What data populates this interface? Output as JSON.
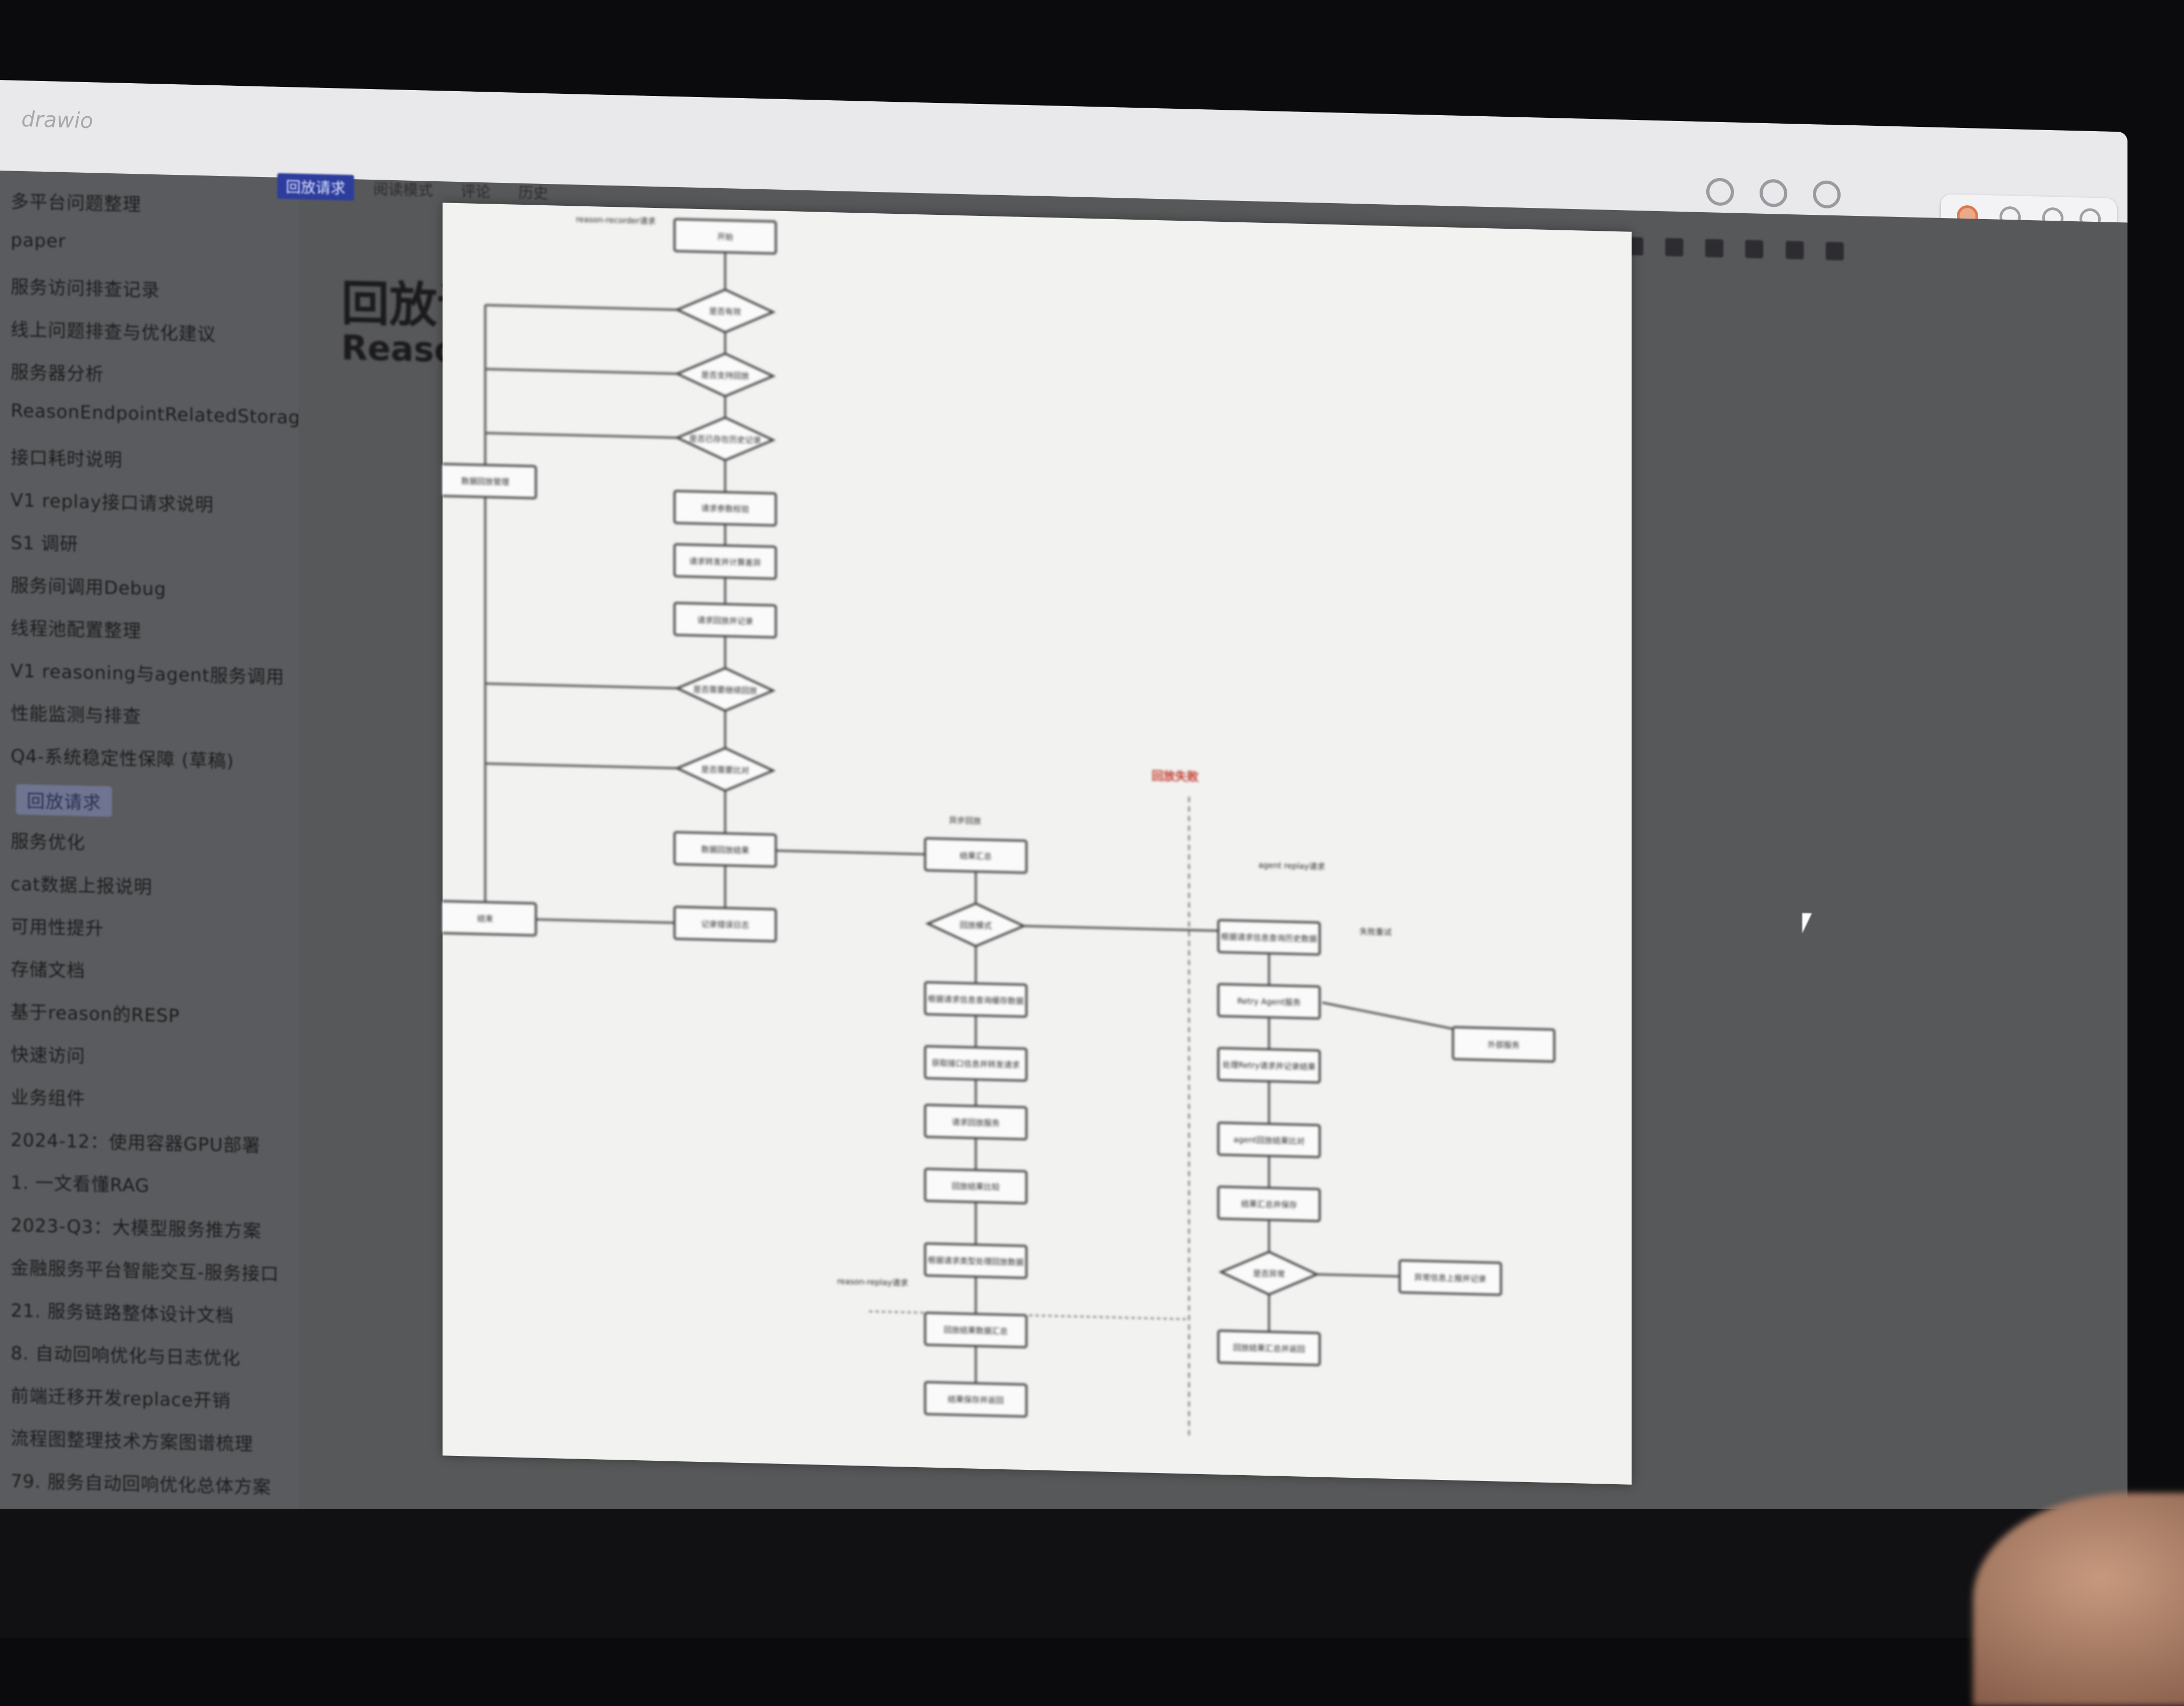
{
  "app": {
    "title": "drawio"
  },
  "sidebar": {
    "items": [
      {
        "label": "多平台问题整理"
      },
      {
        "label": "paper"
      },
      {
        "label": "服务访问排查记录"
      },
      {
        "label": "线上问题排查与优化建议"
      },
      {
        "label": "服务器分析"
      },
      {
        "label": "ReasonEndpointRelatedStorageMgr"
      },
      {
        "label": "接口耗时说明"
      },
      {
        "label": "V1 replay接口请求说明"
      },
      {
        "label": "S1 调研"
      },
      {
        "label": "服务间调用Debug"
      },
      {
        "label": "线程池配置整理"
      },
      {
        "label": "V1 reasoning与agent服务调用"
      },
      {
        "label": "性能监测与排查"
      },
      {
        "label": "Q4-系统稳定性保障 (草稿)"
      },
      {
        "label": "回放请求",
        "active": true
      },
      {
        "label": "服务优化"
      },
      {
        "label": "cat数据上报说明"
      },
      {
        "label": "可用性提升"
      },
      {
        "label": "存储文档"
      },
      {
        "label": "基于reason的RESP"
      },
      {
        "label": "快速访问"
      },
      {
        "label": "业务组件"
      },
      {
        "label": "2024-12：使用容器GPU部署"
      },
      {
        "label": "1. 一文看懂RAG"
      },
      {
        "label": "2023-Q3：大模型服务推方案"
      },
      {
        "label": "金融服务平台智能交互-服务接口"
      },
      {
        "label": "21. 服务链路整体设计文档"
      },
      {
        "label": "8. 自动回响优化与日志优化"
      },
      {
        "label": "前端迁移开发replace开销"
      },
      {
        "label": "流程图整理技术方案图谱梳理"
      },
      {
        "label": "79. 服务自动回响优化总体方案"
      }
    ]
  },
  "tabs": [
    {
      "label": "回放请求",
      "active": true
    },
    {
      "label": "阅读模式"
    },
    {
      "label": "评论"
    },
    {
      "label": "历史"
    }
  ],
  "document": {
    "title": "回放请求",
    "section_title": "Reason"
  },
  "toolbar_icons": [
    "rotate-icon",
    "rotate-icon",
    "refresh-icon",
    "app-icon",
    "settings-icon",
    "share-icon",
    "more-icon"
  ],
  "diagram": {
    "nodes": [
      {
        "id": "n1",
        "shape": "rect",
        "label": "开始"
      },
      {
        "id": "n2",
        "shape": "diamond",
        "label": "是否有效"
      },
      {
        "id": "n3",
        "shape": "diamond",
        "label": "是否支持回放"
      },
      {
        "id": "n4",
        "shape": "diamond",
        "label": "是否已存在历史记录"
      },
      {
        "id": "n5",
        "shape": "rect",
        "label": "请求参数校验"
      },
      {
        "id": "n6",
        "shape": "rect",
        "label": "请求转发并计算差异"
      },
      {
        "id": "n7",
        "shape": "rect",
        "label": "请求回放并记录"
      },
      {
        "id": "n8",
        "shape": "rect",
        "label": "数据回放管理"
      },
      {
        "id": "n9",
        "shape": "diamond",
        "label": "是否需要继续回放"
      },
      {
        "id": "n10",
        "shape": "diamond",
        "label": "是否需要比对"
      },
      {
        "id": "n11",
        "shape": "rect",
        "label": "数据回放结果"
      },
      {
        "id": "n12",
        "shape": "rect",
        "label": "记录错误日志"
      },
      {
        "id": "n13",
        "shape": "rect",
        "label": "结束"
      },
      {
        "id": "n14",
        "shape": "rect",
        "label": "结果汇总"
      },
      {
        "id": "n15",
        "shape": "diamond",
        "label": "回放模式"
      },
      {
        "id": "n16",
        "shape": "rect",
        "label": "根据请求信息查询缓存数据"
      },
      {
        "id": "n17",
        "shape": "rect",
        "label": "获取接口信息并转发请求"
      },
      {
        "id": "n18",
        "shape": "rect",
        "label": "请求回放服务"
      },
      {
        "id": "n19",
        "shape": "rect",
        "label": "回放结果比较"
      },
      {
        "id": "n20",
        "shape": "rect",
        "label": "根据请求类型处理回放数据"
      },
      {
        "id": "n21",
        "shape": "rect",
        "label": "回放结果数据汇总"
      },
      {
        "id": "n22",
        "shape": "rect",
        "label": "结果保存并返回"
      },
      {
        "id": "n23",
        "shape": "rect",
        "label": "根据请求信息查询历史数据"
      },
      {
        "id": "n24",
        "shape": "rect",
        "label": "Retry Agent服务"
      },
      {
        "id": "n25",
        "shape": "rect",
        "label": "处理Retry请求并记录结果"
      },
      {
        "id": "n26",
        "shape": "rect",
        "label": "agent回放结果比对"
      },
      {
        "id": "n27",
        "shape": "rect",
        "label": "结果汇总并保存"
      },
      {
        "id": "n28",
        "shape": "diamond",
        "label": "是否异常"
      },
      {
        "id": "n29",
        "shape": "rect",
        "label": "异常信息上报并记录"
      },
      {
        "id": "n30",
        "shape": "rect",
        "label": "回放结果汇总并返回"
      },
      {
        "id": "n31",
        "shape": "rect",
        "label": "外部服务"
      }
    ],
    "annotations": [
      {
        "label": "reason-recorder请求"
      },
      {
        "label": "agent replay请求"
      },
      {
        "label": "reason-replay请求"
      },
      {
        "label": "回放失败"
      },
      {
        "label": "异步回放"
      },
      {
        "label": "失败重试"
      }
    ]
  },
  "colors": {
    "accent": "#2c3d9e",
    "annotation_red": "#c0392b"
  }
}
